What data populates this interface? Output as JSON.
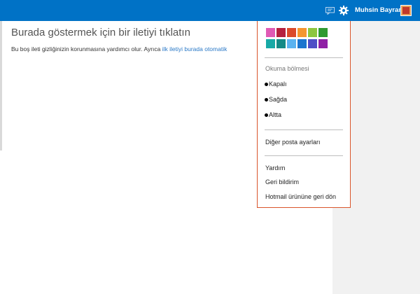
{
  "header": {
    "user_name": "Muhsin Bayram",
    "icons": [
      "feedback-icon",
      "gear-icon"
    ]
  },
  "reading_pane": {
    "title": "Burada göstermek için bir iletiyi tıklatın",
    "description_prefix": "Bu boş ileti gizliğinizin korunmasına yardımcı olur. Ayrıca ",
    "description_link": "ilk iletiyi burada otomatik"
  },
  "settings_menu": {
    "theme_colors": [
      "#e05ab5",
      "#b5203e",
      "#db4a2a",
      "#f5962f",
      "#8dc63f",
      "#2f9a31",
      "#17a9a6",
      "#138a86",
      "#5ab3f0",
      "#1a75ce",
      "#4f4ec6",
      "#8f21a5"
    ],
    "reading_pane_heading": "Okuma bölmesi",
    "reading_pane_options": [
      "Kapalı",
      "Sağda",
      "Altta"
    ],
    "other_settings": "Diğer posta ayarları",
    "help": "Yardım",
    "feedback": "Geri bildirim",
    "back_to_hotmail": "Hotmail ürününe geri dön"
  },
  "colors": {
    "header_bg": "#0072c6",
    "menu_border": "#d9552b",
    "link": "#2a79c7"
  }
}
